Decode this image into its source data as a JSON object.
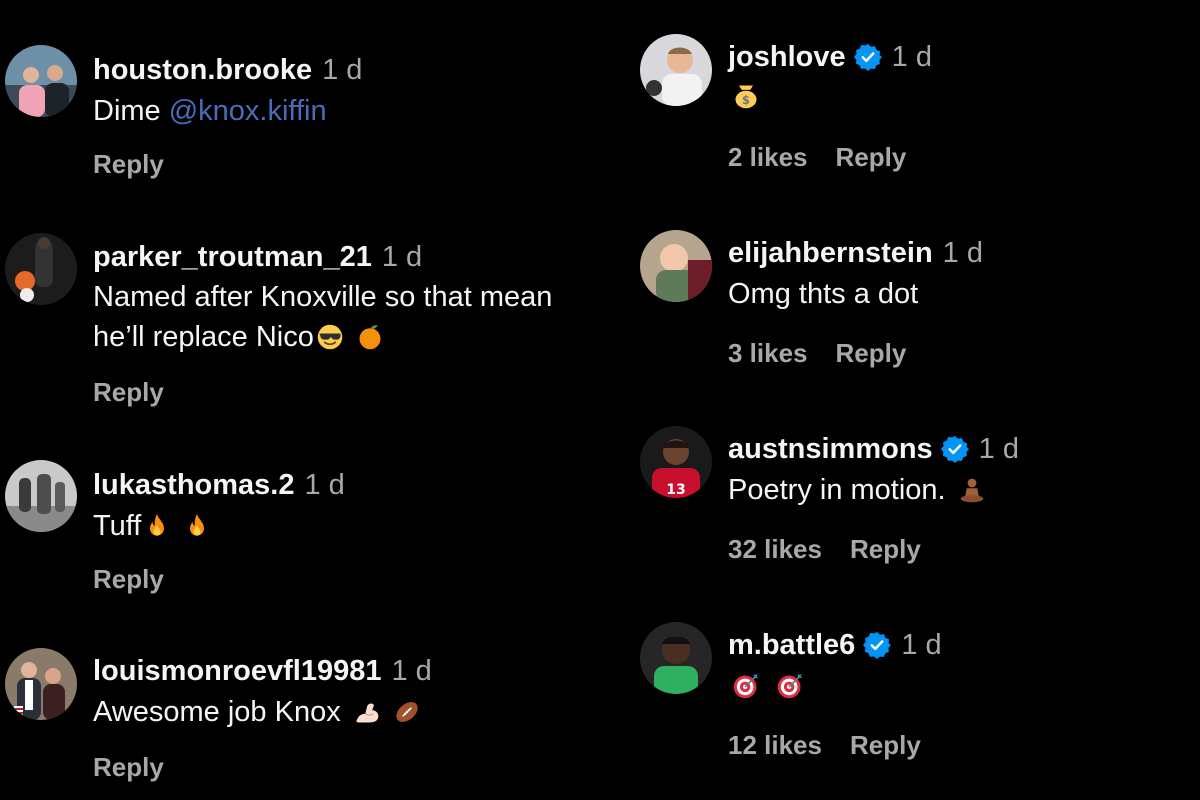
{
  "left_comments": [
    {
      "username": "houston.brooke",
      "time": "1 d",
      "text": "Dime ",
      "mention": "@knox.kiffin",
      "reply": "Reply"
    },
    {
      "username": "parker_troutman_21",
      "time": "1 d",
      "text_line1": "Named after Knoxville so that mean",
      "text_line2": "he’ll replace Nico",
      "emojis": [
        "sunglasses-smile-emoji",
        "tangerine-emoji"
      ],
      "reply": "Reply"
    },
    {
      "username": "lukasthomas.2",
      "time": "1 d",
      "text": "Tuff",
      "emojis": [
        "fire-emoji",
        "fire-emoji"
      ],
      "reply": "Reply"
    },
    {
      "username": "louismonroevfl19981",
      "time": "1 d",
      "text": "Awesome job Knox",
      "emojis": [
        "flexed-biceps-emoji",
        "football-emoji"
      ],
      "reply": "Reply"
    }
  ],
  "right_comments": [
    {
      "username": "joshlove",
      "verified": true,
      "time": "1 d",
      "emojis": [
        "money-bag-emoji"
      ],
      "likes": "2 likes",
      "reply": "Reply"
    },
    {
      "username": "elijahbernstein",
      "verified": false,
      "time": "1 d",
      "text": "Omg thts a dot",
      "likes": "3 likes",
      "reply": "Reply"
    },
    {
      "username": "austnsimmons",
      "verified": true,
      "time": "1 d",
      "text": "Poetry in motion.",
      "emojis": [
        "person-meditating-emoji"
      ],
      "likes": "32 likes",
      "reply": "Reply"
    },
    {
      "username": "m.battle6",
      "verified": true,
      "time": "1 d",
      "emojis": [
        "direct-hit-emoji",
        "direct-hit-emoji"
      ],
      "likes": "12 likes",
      "reply": "Reply"
    }
  ],
  "colors": {
    "background": "#000000",
    "text": "#f5f5f5",
    "secondary": "#a8a8a8",
    "mention": "#4a6cb8",
    "verified": "#0095f6"
  }
}
